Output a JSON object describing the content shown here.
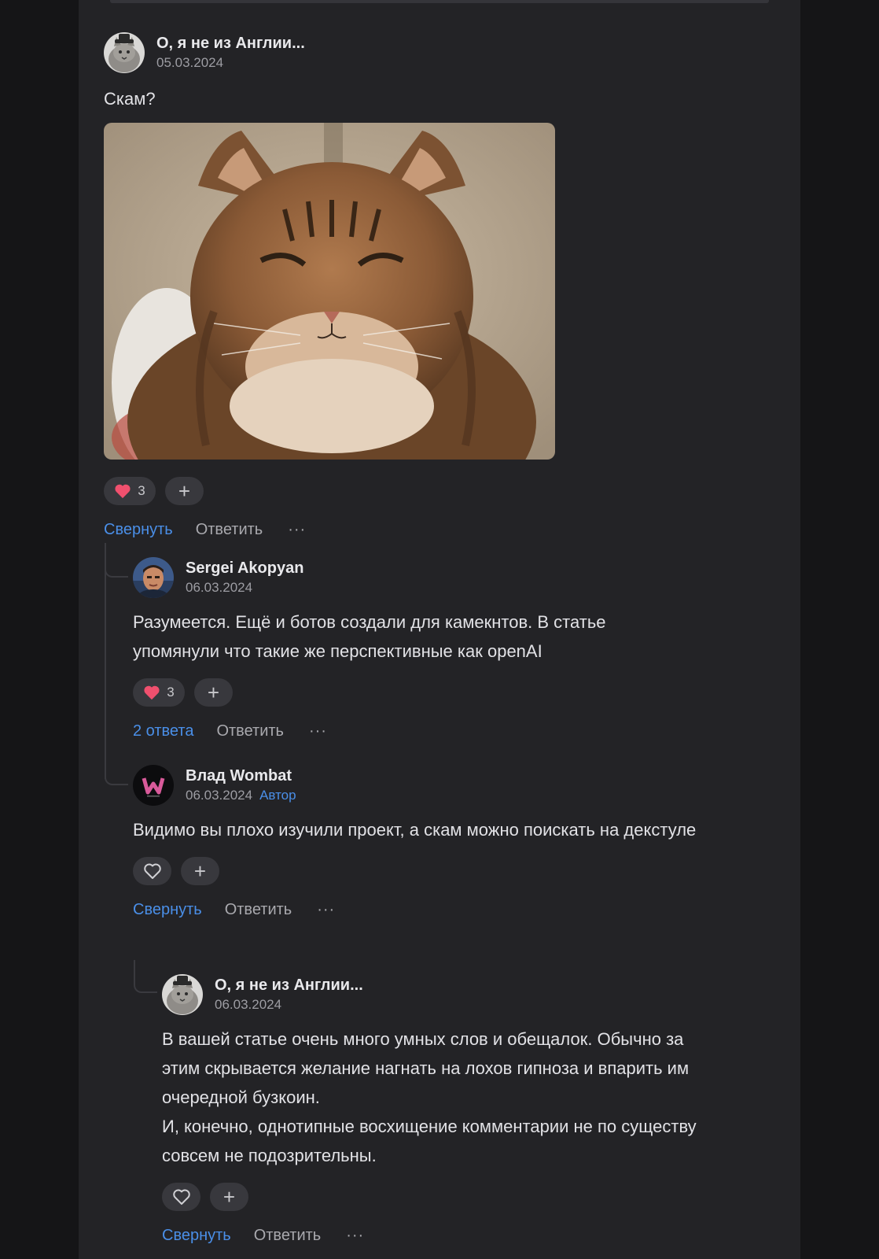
{
  "colors": {
    "background": "#151517",
    "panel": "#232326",
    "accent": "#4a8fe8",
    "heart": "#f0506e"
  },
  "comments": [
    {
      "author": "О, я не из Англии...",
      "date": "05.03.2024",
      "text": "Скам?",
      "has_image": true,
      "image_subject": "tabby-cat-photo",
      "reaction_count": "3",
      "primary_action": "Свернуть",
      "reply_label": "Ответить",
      "more_label": "···"
    },
    {
      "author": "Sergei Akopyan",
      "date": "06.03.2024",
      "text": "Разумеется. Ещё и ботов создали для камекнтов. В статье упомянули что такие же перспективные как openAI",
      "reaction_count": "3",
      "primary_action": "2 ответа",
      "reply_label": "Ответить",
      "more_label": "···"
    },
    {
      "author": "Влад Wombat",
      "date": "06.03.2024",
      "badge": "Автор",
      "text": "Видимо вы плохо изучили проект, а скам можно поискать на декстуле",
      "primary_action": "Свернуть",
      "reply_label": "Ответить",
      "more_label": "···"
    },
    {
      "author": "О, я не из Англии...",
      "date": "06.03.2024",
      "text_lines": [
        "В вашей статье очень много умных слов и обещалок. Обычно за этим скрывается желание нагнать на лохов гипноза и впарить им очередной бузкоин.",
        "И, конечно, однотипные восхищение комментарии не по существу совсем не подозрительны."
      ],
      "primary_action": "Свернуть",
      "reply_label": "Ответить",
      "more_label": "···"
    }
  ]
}
